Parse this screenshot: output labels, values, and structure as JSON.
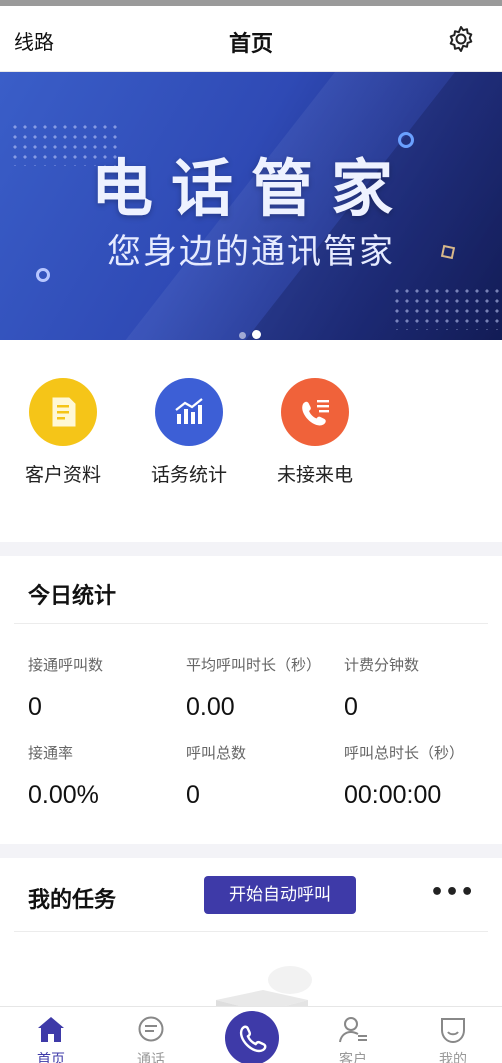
{
  "header": {
    "left_label": "线路",
    "title": "首页",
    "settings_icon": "gear-icon"
  },
  "banner": {
    "headline": "电话管家",
    "subtitle": "您身边的通讯管家",
    "pager": {
      "count": 2,
      "active_index": 1
    }
  },
  "quick_actions": [
    {
      "label": "客户资料",
      "icon": "document-icon",
      "color": "#f5c518"
    },
    {
      "label": "话务统计",
      "icon": "bar-chart-icon",
      "color": "#3d5fd6"
    },
    {
      "label": "未接来电",
      "icon": "phone-list-icon",
      "color": "#f0623a"
    }
  ],
  "stats": {
    "title": "今日统计",
    "items": [
      {
        "label": "接通呼叫数",
        "value": "0"
      },
      {
        "label": "平均呼叫时长（秒）",
        "value": "0.00"
      },
      {
        "label": "计费分钟数",
        "value": "0"
      },
      {
        "label": "接通率",
        "value": "0.00%"
      },
      {
        "label": "呼叫总数",
        "value": "0"
      },
      {
        "label": "呼叫总时长（秒）",
        "value": "00:00:00"
      }
    ]
  },
  "tasks": {
    "title": "我的任务",
    "auto_call_button": "开始自动呼叫",
    "more_label": "•••"
  },
  "tabbar": {
    "tabs": [
      {
        "label": "首页",
        "icon": "home-icon",
        "active": true
      },
      {
        "label": "通话",
        "icon": "chat-icon",
        "active": false
      },
      {
        "label": "客户",
        "icon": "contacts-icon",
        "active": false
      },
      {
        "label": "我的",
        "icon": "profile-icon",
        "active": false
      }
    ],
    "center_call_icon": "phone-icon"
  },
  "colors": {
    "primary": "#3e3aa8",
    "banner_dark": "#15205e",
    "banner_light": "#3a5ec8",
    "separator": "#f3f3f7"
  }
}
